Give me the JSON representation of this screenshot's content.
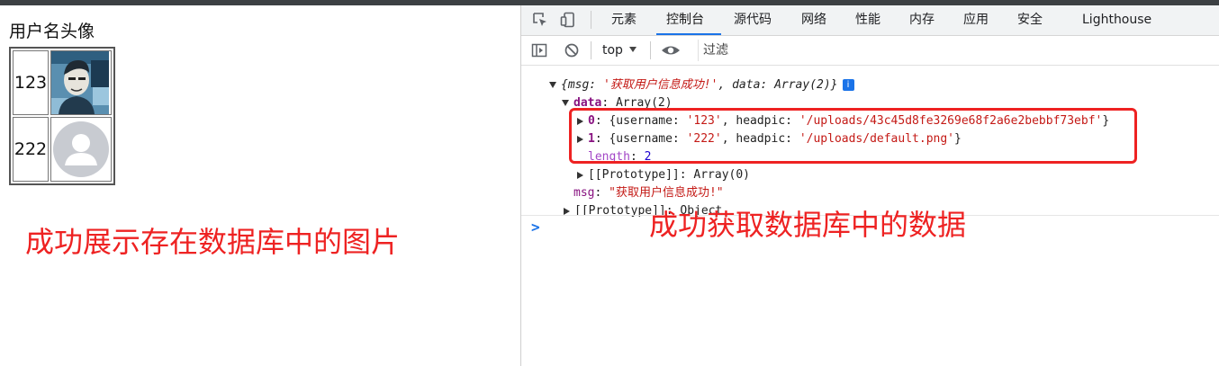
{
  "page": {
    "title": "用户名头像",
    "users": [
      {
        "name": "123",
        "avatar": "user-photo-icon"
      },
      {
        "name": "222",
        "avatar": "default-avatar-icon"
      }
    ],
    "annotation": "成功展示存在数据库中的图片"
  },
  "devtools": {
    "tabs": [
      "元素",
      "控制台",
      "源代码",
      "网络",
      "性能",
      "内存",
      "应用",
      "安全",
      "Lighthouse"
    ],
    "active_tab": "控制台",
    "context": "top",
    "filter_placeholder": "过滤",
    "console": {
      "summary_prefix": "{msg: ",
      "summary_msg": "'获取用户信息成功!'",
      "summary_mid": ", data: Array(2)}",
      "info_badge": "i",
      "data_key": "data",
      "data_value": ": Array(2)",
      "items": [
        {
          "index": "0",
          "pre": ": {username: ",
          "username": "'123'",
          "mid": ", headpic: ",
          "headpic": "'/uploads/43c45d8fe3269e68f2a6e2bebbf73ebf'",
          "post": "}"
        },
        {
          "index": "1",
          "pre": ": {username: ",
          "username": "'222'",
          "mid": ", headpic: ",
          "headpic": "'/uploads/default.png'",
          "post": "}"
        }
      ],
      "length_key": "length",
      "length_sep": ": ",
      "length_value": "2",
      "array_proto": "[[Prototype]]: Array(0)",
      "msg_key": "msg",
      "msg_value": "\"获取用户信息成功!\"",
      "object_proto": "[[Prototype]]: Object",
      "prompt": ">"
    },
    "annotation": "成功获取数据库中的数据",
    "accent_color": "#1a73e8",
    "annotation_color": "#ee2222"
  }
}
